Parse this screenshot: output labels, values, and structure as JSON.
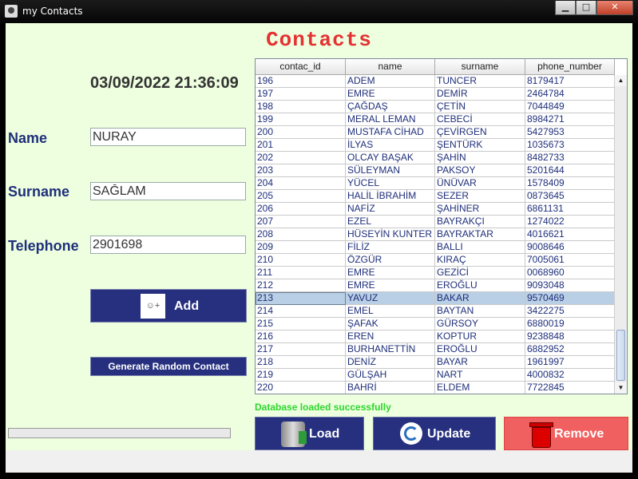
{
  "window": {
    "title": "my Contacts",
    "minimize_glyph": "▁",
    "maximize_glyph": "□",
    "close_glyph": "✕"
  },
  "header": {
    "title": "Contacts",
    "datetime": "03/09/2022 21:36:09"
  },
  "form": {
    "name_label": "Name",
    "name_value": "NURAY",
    "surname_label": "Surname",
    "surname_value": "SAĞLAM",
    "telephone_label": "Telephone",
    "telephone_value": "2901698",
    "add_label": "Add",
    "add_icon": "add-user-icon",
    "random_label": "Generate Random Contact"
  },
  "table": {
    "columns": [
      "contac_id",
      "name",
      "surname",
      "phone_number"
    ],
    "selected_id": "213",
    "rows": [
      [
        "196",
        "ADEM",
        "TUNCER",
        "8179417"
      ],
      [
        "197",
        "EMRE",
        "DEMİR",
        "2464784"
      ],
      [
        "198",
        "ÇAĞDAŞ",
        "ÇETİN",
        "7044849"
      ],
      [
        "199",
        "MERAL LEMAN",
        "CEBECİ",
        "8984271"
      ],
      [
        "200",
        "MUSTAFA CİHAD",
        "ÇEVİRGEN",
        "5427953"
      ],
      [
        "201",
        "İLYAS",
        "ŞENTÜRK",
        "1035673"
      ],
      [
        "202",
        "OLCAY BAŞAK",
        "ŞAHİN",
        "8482733"
      ],
      [
        "203",
        "SÜLEYMAN",
        "PAKSOY",
        "5201644"
      ],
      [
        "204",
        "YÜCEL",
        "ÜNÜVAR",
        "1578409"
      ],
      [
        "205",
        "HALİL İBRAHİM",
        "SEZER",
        "0873645"
      ],
      [
        "206",
        "NAFİZ",
        "ŞAHİNER",
        "6861131"
      ],
      [
        "207",
        "EZEL",
        "BAYRAKÇI",
        "1274022"
      ],
      [
        "208",
        "HÜSEYİN KUNTER",
        "BAYRAKTAR",
        "4016621"
      ],
      [
        "209",
        "FİLİZ",
        "BALLI",
        "9008646"
      ],
      [
        "210",
        "ÖZGÜR",
        "KIRAÇ",
        "7005061"
      ],
      [
        "211",
        "EMRE",
        "GEZİCİ",
        "0068960"
      ],
      [
        "212",
        "EMRE",
        "EROĞLU",
        "9093048"
      ],
      [
        "213",
        "YAVUZ",
        "BAKAR",
        "9570469"
      ],
      [
        "214",
        "EMEL",
        "BAYTAN",
        "3422275"
      ],
      [
        "215",
        "ŞAFAK",
        "GÜRSOY",
        "6880019"
      ],
      [
        "216",
        "EREN",
        "KOPTUR",
        "9238848"
      ],
      [
        "217",
        "BURHANETTİN",
        "EROĞLU",
        "6882952"
      ],
      [
        "218",
        "DENİZ",
        "BAYAR",
        "1961997"
      ],
      [
        "219",
        "GÜLŞAH",
        "NART",
        "4000832"
      ],
      [
        "220",
        "BAHRİ",
        "ELDEM",
        "7722845"
      ]
    ]
  },
  "status": {
    "text": "Database loaded successfully",
    "color": "#2cd62c"
  },
  "actions": {
    "load_label": "Load",
    "update_label": "Update",
    "remove_label": "Remove"
  },
  "colors": {
    "heading": "#e53131",
    "button_blue": "#26307f",
    "remove_red": "#f16060",
    "panel_green": "#eeffdf",
    "label_blue": "#1f2f7a"
  },
  "progress": {
    "value": 0
  }
}
